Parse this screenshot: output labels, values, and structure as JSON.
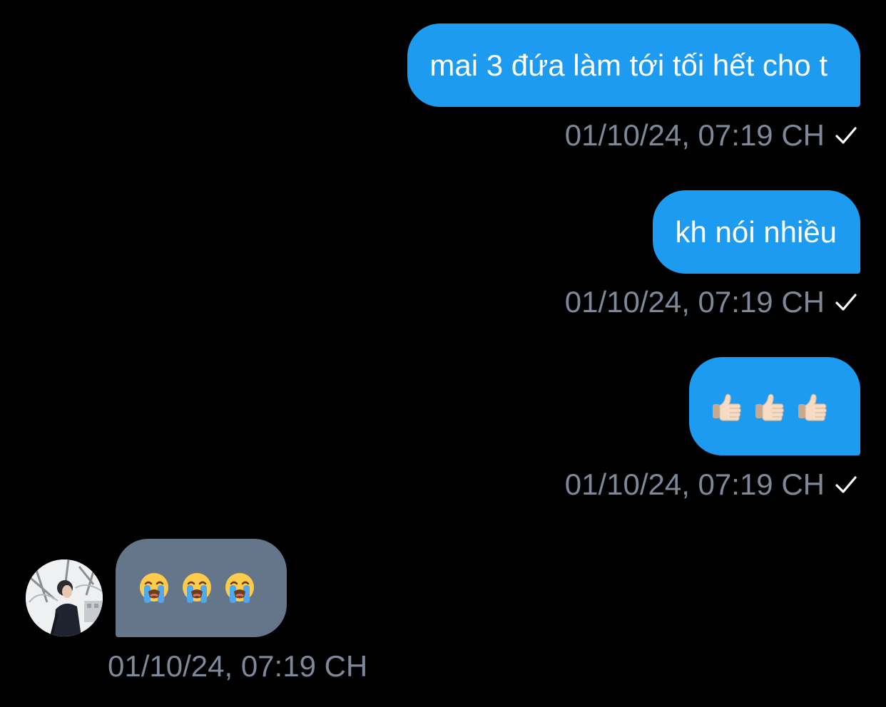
{
  "messages": [
    {
      "direction": "outgoing",
      "text": "mai 3 đứa làm tới tối hết cho t",
      "timestamp": "01/10/24, 07:19 CH",
      "status_icon": "checkmark-icon"
    },
    {
      "direction": "outgoing",
      "text": "kh nói nhiều",
      "timestamp": "01/10/24, 07:19 CH",
      "status_icon": "checkmark-icon"
    },
    {
      "direction": "outgoing",
      "emojis": [
        "thumbs-up-light-skin",
        "thumbs-up-light-skin",
        "thumbs-up-light-skin"
      ],
      "timestamp": "01/10/24, 07:19 CH",
      "status_icon": "checkmark-icon"
    },
    {
      "direction": "incoming",
      "emojis": [
        "loudly-crying-face",
        "loudly-crying-face",
        "loudly-crying-face"
      ],
      "timestamp": "01/10/24, 07:19 CH",
      "avatar": "contact-avatar"
    }
  ],
  "colors": {
    "background": "#000000",
    "outgoing_bubble": "#1d9bf0",
    "incoming_bubble": "#65758a",
    "timestamp": "#7d8998",
    "text": "#ffffff"
  }
}
